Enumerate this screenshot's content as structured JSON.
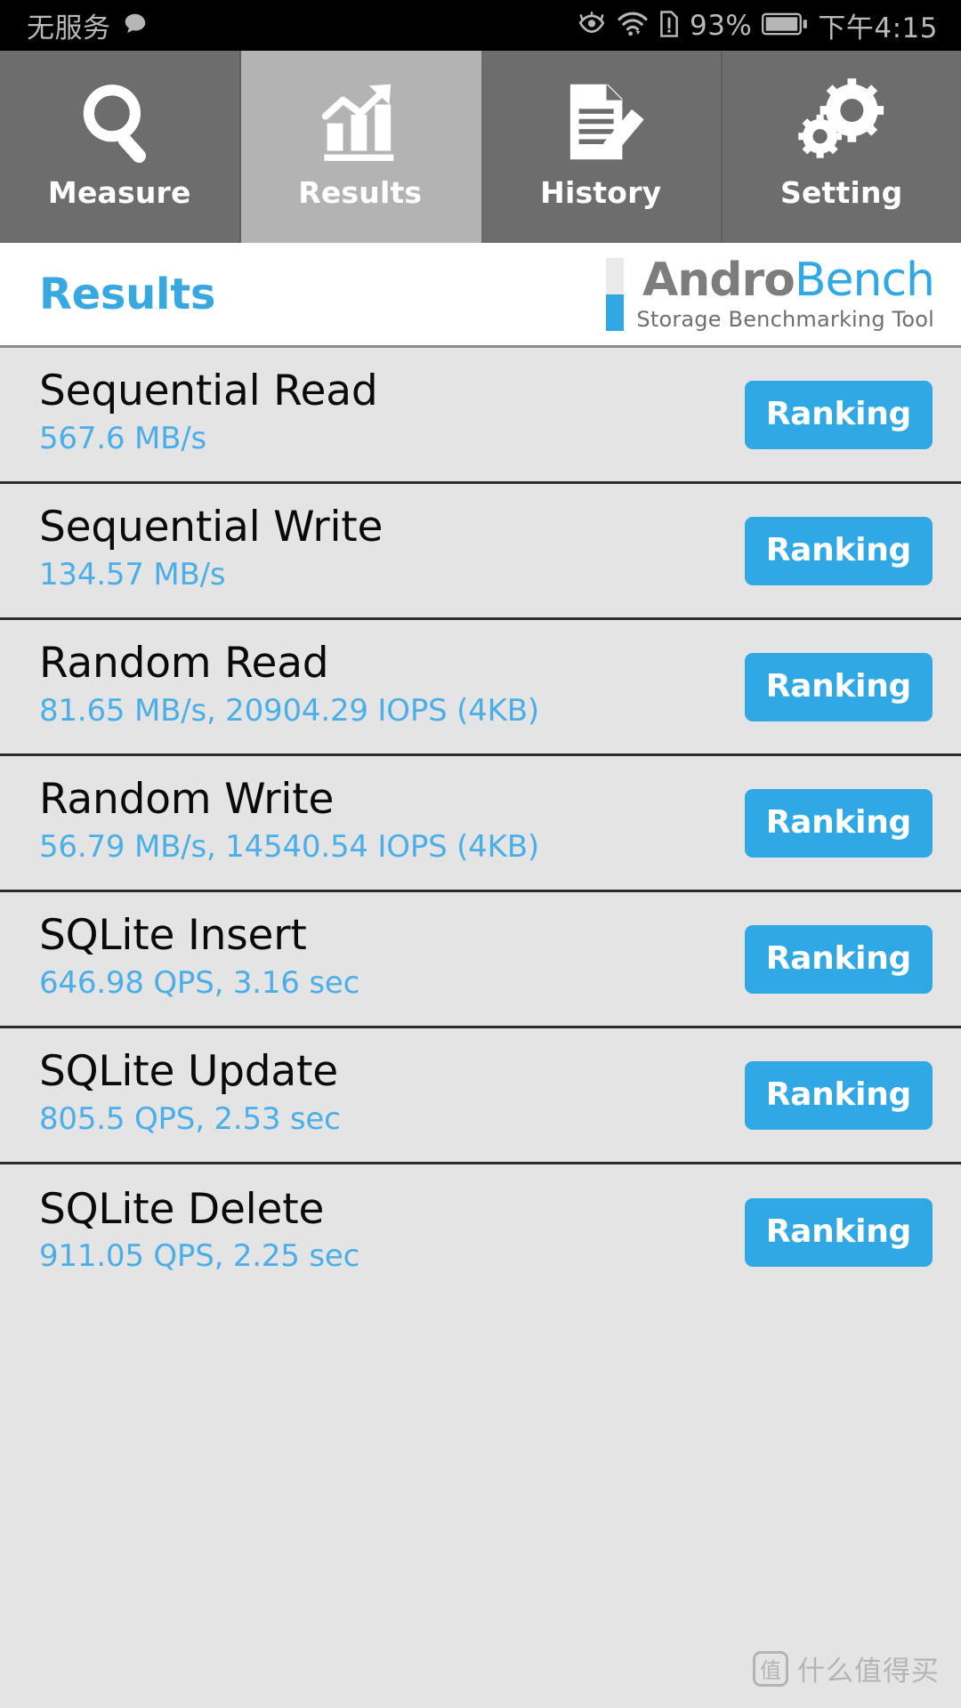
{
  "status_bar": {
    "carrier": "无服务",
    "message_icon": "speech-bubble-icon",
    "eye_comfort_icon": "eye-comfort-icon",
    "wifi_icon": "wifi-icon",
    "sim_icon": "no-sim-card-icon",
    "battery_percent": "93%",
    "battery_icon": "battery-full-icon",
    "time": "下午4:15"
  },
  "tabs": [
    {
      "label": "Measure",
      "icon": "magnifier-icon",
      "active": false
    },
    {
      "label": "Results",
      "icon": "bar-chart-arrow-icon",
      "active": true
    },
    {
      "label": "History",
      "icon": "document-pencil-icon",
      "active": false
    },
    {
      "label": "Setting",
      "icon": "gears-icon",
      "active": false
    }
  ],
  "header": {
    "title": "Results",
    "logo_first": "Andro",
    "logo_second": "Bench",
    "logo_subtitle": "Storage Benchmarking Tool"
  },
  "results": [
    {
      "name": "Sequential Read",
      "value": "567.6 MB/s",
      "button": "Ranking"
    },
    {
      "name": "Sequential Write",
      "value": "134.57 MB/s",
      "button": "Ranking"
    },
    {
      "name": "Random Read",
      "value": "81.65 MB/s, 20904.29 IOPS (4KB)",
      "button": "Ranking"
    },
    {
      "name": "Random Write",
      "value": "56.79 MB/s, 14540.54 IOPS (4KB)",
      "button": "Ranking"
    },
    {
      "name": "SQLite Insert",
      "value": "646.98 QPS, 3.16 sec",
      "button": "Ranking"
    },
    {
      "name": "SQLite Update",
      "value": "805.5 QPS, 2.53 sec",
      "button": "Ranking"
    },
    {
      "name": "SQLite Delete",
      "value": "911.05 QPS, 2.25 sec",
      "button": "Ranking"
    }
  ],
  "watermark": {
    "badge": "值",
    "text": "什么值得买"
  },
  "colors": {
    "accent_blue": "#2fa8e5",
    "value_blue": "#4aafe8",
    "tab_inactive": "#6d6d6d",
    "tab_active": "#b3b3b3",
    "row_background": "#e4e4e4"
  }
}
